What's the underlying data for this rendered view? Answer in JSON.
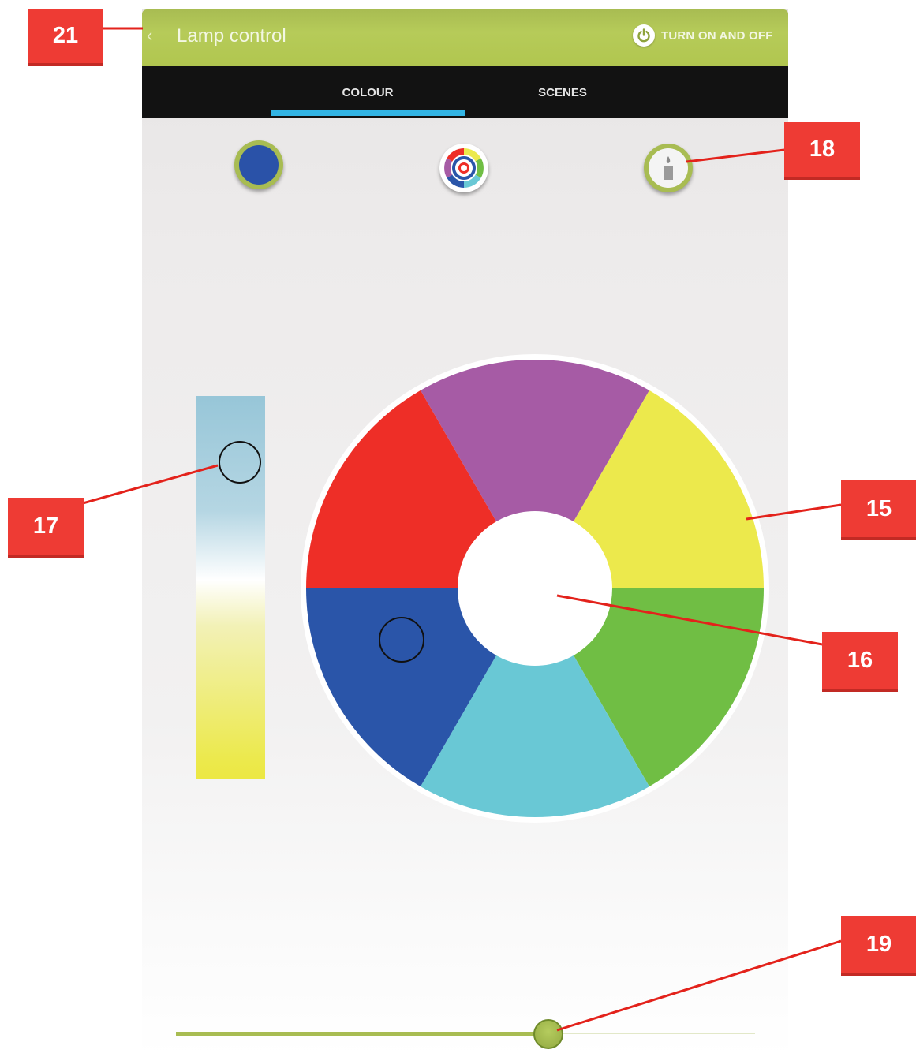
{
  "header": {
    "back_glyph": "‹",
    "title": "Lamp control",
    "power_label": "TURN ON AND OFF",
    "accent": "#a8bc52"
  },
  "tabs": [
    {
      "label": "COLOUR",
      "selected": true
    },
    {
      "label": "SCENES",
      "selected": false
    }
  ],
  "modes": [
    {
      "name": "solid-colour",
      "color": "#2a52a8"
    },
    {
      "name": "colour-wheel"
    },
    {
      "name": "candle"
    }
  ],
  "wheel": {
    "segments": [
      {
        "name": "purple",
        "color": "#a65ba5"
      },
      {
        "name": "yellow",
        "color": "#ece94c"
      },
      {
        "name": "green",
        "color": "#70be44"
      },
      {
        "name": "cyan",
        "color": "#69c8d5"
      },
      {
        "name": "blue",
        "color": "#2a55a9"
      },
      {
        "name": "red",
        "color": "#ee2e27"
      }
    ],
    "selected": "blue"
  },
  "brightness_slider": {
    "value_fraction": 0.64
  },
  "callouts": [
    "21",
    "18",
    "17",
    "15",
    "16",
    "19"
  ]
}
